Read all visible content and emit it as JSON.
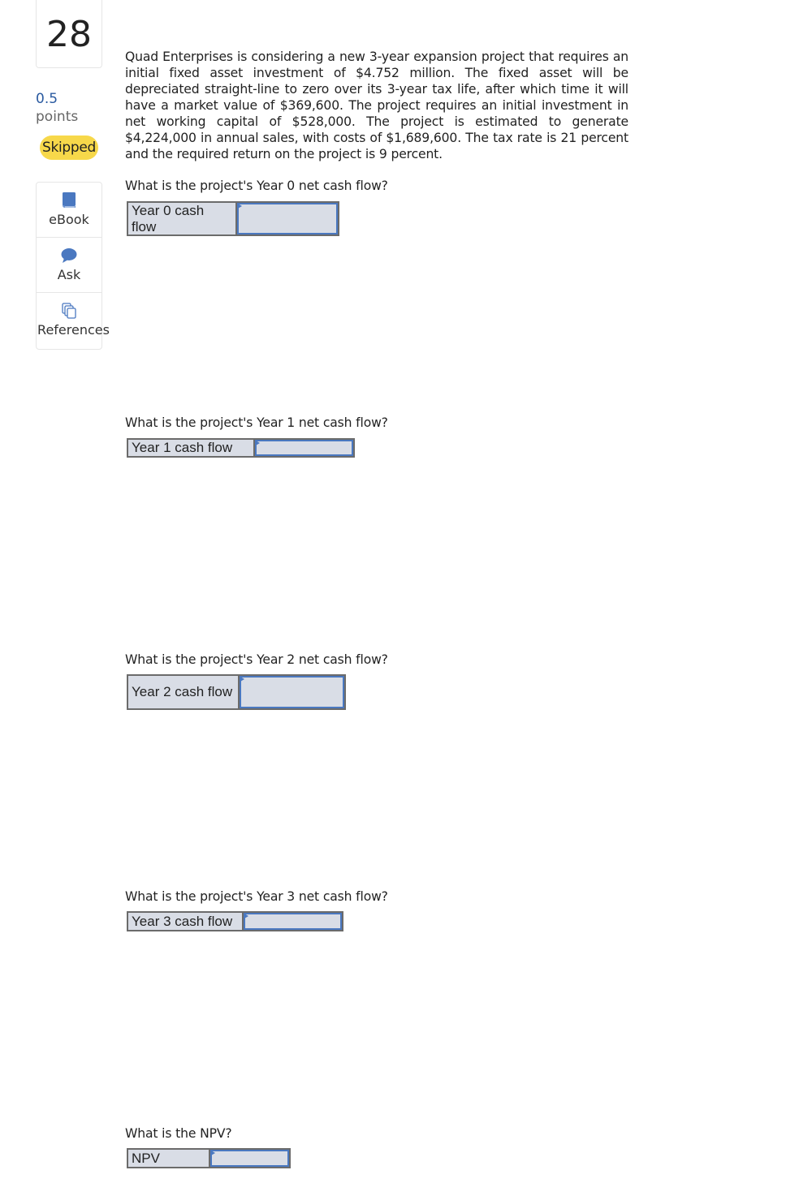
{
  "sidebar": {
    "question_number": "28",
    "points_value": "0.5",
    "points_label": "points",
    "status_badge": "Skipped",
    "tools": [
      {
        "label": "eBook",
        "icon": "book-icon"
      },
      {
        "label": "Ask",
        "icon": "speech-bubble-icon"
      },
      {
        "label": "References",
        "icon": "copy-documents-icon"
      }
    ]
  },
  "problem": {
    "text": "Quad Enterprises is considering a new 3-year expansion project that requires an initial fixed asset investment of $4.752 million. The fixed asset will be depreciated straight-line to zero over its 3-year tax life, after which time it will have a market value of $369,600. The project requires an initial investment in net working capital of $528,000. The project is estimated to generate $4,224,000 in annual sales, with costs of $1,689,600. The tax rate is 21 percent and the required return on the project is 9 percent."
  },
  "questions": [
    {
      "prompt": "What is the project's Year 0 net cash flow?",
      "label": "Year 0 cash flow",
      "value": "",
      "placeholder": ""
    },
    {
      "prompt": "What is the project's Year 1 net cash flow?",
      "label": "Year 1 cash flow",
      "value": "",
      "placeholder": ""
    },
    {
      "prompt": "What is the project's Year 2 net cash flow?",
      "label": "Year 2 cash flow",
      "value": "",
      "placeholder": ""
    },
    {
      "prompt": "What is the project's Year 3 net cash flow?",
      "label": "Year 3 cash flow",
      "value": "",
      "placeholder": ""
    },
    {
      "prompt": "What is the NPV?",
      "label": "NPV",
      "value": "",
      "placeholder": ""
    }
  ],
  "colors": {
    "points_blue": "#2a5aa0",
    "skipped_badge": "#f7d84a",
    "icon_blue": "#4a78c0",
    "input_bg": "#d9dde6",
    "table_border": "#6b6b6b"
  }
}
